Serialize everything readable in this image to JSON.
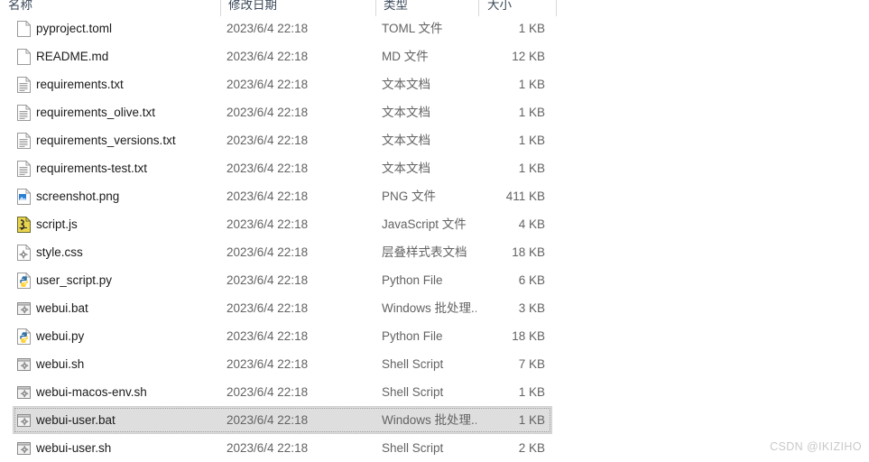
{
  "columns": {
    "name": "名称",
    "modified": "修改日期",
    "type": "类型",
    "size": "大小"
  },
  "watermark": "CSDN @IKIZIHO",
  "colors": {
    "selection_bg": "#dedede",
    "selection_border": "#d0d0d0",
    "name_text": "#1b1b1b",
    "meta_text": "#636363",
    "header_text": "#3b4a5a",
    "divider": "#d8d8d8",
    "background": "#ffffff",
    "watermark_text": "#c9c9c9",
    "icon_outline": "#9a9a9a",
    "png_blue": "#2a7fd4",
    "js_yellow": "#e8d44d",
    "py_blue": "#3572a5",
    "py_yellow": "#ffd43b",
    "bat_grey": "#8a8a8a"
  },
  "files": [
    {
      "name": "pyproject.toml",
      "modified": "2023/6/4 22:18",
      "type": "TOML 文件",
      "size": "1 KB",
      "icon": "file-blank-icon",
      "selected": false
    },
    {
      "name": "README.md",
      "modified": "2023/6/4 22:18",
      "type": "MD 文件",
      "size": "12 KB",
      "icon": "file-blank-icon",
      "selected": false
    },
    {
      "name": "requirements.txt",
      "modified": "2023/6/4 22:18",
      "type": "文本文档",
      "size": "1 KB",
      "icon": "file-text-icon",
      "selected": false
    },
    {
      "name": "requirements_olive.txt",
      "modified": "2023/6/4 22:18",
      "type": "文本文档",
      "size": "1 KB",
      "icon": "file-text-icon",
      "selected": false
    },
    {
      "name": "requirements_versions.txt",
      "modified": "2023/6/4 22:18",
      "type": "文本文档",
      "size": "1 KB",
      "icon": "file-text-icon",
      "selected": false
    },
    {
      "name": "requirements-test.txt",
      "modified": "2023/6/4 22:18",
      "type": "文本文档",
      "size": "1 KB",
      "icon": "file-text-icon",
      "selected": false
    },
    {
      "name": "screenshot.png",
      "modified": "2023/6/4 22:18",
      "type": "PNG 文件",
      "size": "411 KB",
      "icon": "file-image-icon",
      "selected": false
    },
    {
      "name": "script.js",
      "modified": "2023/6/4 22:18",
      "type": "JavaScript 文件",
      "size": "4 KB",
      "icon": "file-js-icon",
      "selected": false
    },
    {
      "name": "style.css",
      "modified": "2023/6/4 22:18",
      "type": "层叠样式表文档",
      "size": "18 KB",
      "icon": "file-css-icon",
      "selected": false
    },
    {
      "name": "user_script.py",
      "modified": "2023/6/4 22:18",
      "type": "Python File",
      "size": "6 KB",
      "icon": "file-python-icon",
      "selected": false
    },
    {
      "name": "webui.bat",
      "modified": "2023/6/4 22:18",
      "type": "Windows 批处理...",
      "size": "3 KB",
      "icon": "file-batch-icon",
      "selected": false
    },
    {
      "name": "webui.py",
      "modified": "2023/6/4 22:18",
      "type": "Python File",
      "size": "18 KB",
      "icon": "file-python-icon",
      "selected": false
    },
    {
      "name": "webui.sh",
      "modified": "2023/6/4 22:18",
      "type": "Shell Script",
      "size": "7 KB",
      "icon": "file-batch-icon",
      "selected": false
    },
    {
      "name": "webui-macos-env.sh",
      "modified": "2023/6/4 22:18",
      "type": "Shell Script",
      "size": "1 KB",
      "icon": "file-batch-icon",
      "selected": false
    },
    {
      "name": "webui-user.bat",
      "modified": "2023/6/4 22:18",
      "type": "Windows 批处理...",
      "size": "1 KB",
      "icon": "file-batch-icon",
      "selected": true
    },
    {
      "name": "webui-user.sh",
      "modified": "2023/6/4 22:18",
      "type": "Shell Script",
      "size": "2 KB",
      "icon": "file-batch-icon",
      "selected": false
    }
  ]
}
